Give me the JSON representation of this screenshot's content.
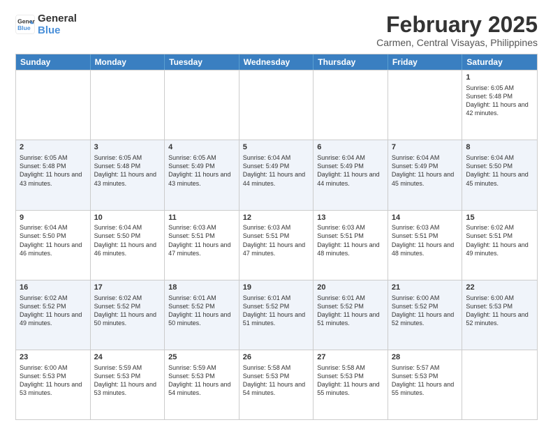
{
  "header": {
    "logo_line1": "General",
    "logo_line2": "Blue",
    "month_year": "February 2025",
    "location": "Carmen, Central Visayas, Philippines"
  },
  "weekdays": [
    "Sunday",
    "Monday",
    "Tuesday",
    "Wednesday",
    "Thursday",
    "Friday",
    "Saturday"
  ],
  "rows": [
    {
      "alt": false,
      "cells": [
        {
          "day": "",
          "text": ""
        },
        {
          "day": "",
          "text": ""
        },
        {
          "day": "",
          "text": ""
        },
        {
          "day": "",
          "text": ""
        },
        {
          "day": "",
          "text": ""
        },
        {
          "day": "",
          "text": ""
        },
        {
          "day": "1",
          "text": "Sunrise: 6:05 AM\nSunset: 5:48 PM\nDaylight: 11 hours and 42 minutes."
        }
      ]
    },
    {
      "alt": true,
      "cells": [
        {
          "day": "2",
          "text": "Sunrise: 6:05 AM\nSunset: 5:48 PM\nDaylight: 11 hours and 43 minutes."
        },
        {
          "day": "3",
          "text": "Sunrise: 6:05 AM\nSunset: 5:48 PM\nDaylight: 11 hours and 43 minutes."
        },
        {
          "day": "4",
          "text": "Sunrise: 6:05 AM\nSunset: 5:49 PM\nDaylight: 11 hours and 43 minutes."
        },
        {
          "day": "5",
          "text": "Sunrise: 6:04 AM\nSunset: 5:49 PM\nDaylight: 11 hours and 44 minutes."
        },
        {
          "day": "6",
          "text": "Sunrise: 6:04 AM\nSunset: 5:49 PM\nDaylight: 11 hours and 44 minutes."
        },
        {
          "day": "7",
          "text": "Sunrise: 6:04 AM\nSunset: 5:49 PM\nDaylight: 11 hours and 45 minutes."
        },
        {
          "day": "8",
          "text": "Sunrise: 6:04 AM\nSunset: 5:50 PM\nDaylight: 11 hours and 45 minutes."
        }
      ]
    },
    {
      "alt": false,
      "cells": [
        {
          "day": "9",
          "text": "Sunrise: 6:04 AM\nSunset: 5:50 PM\nDaylight: 11 hours and 46 minutes."
        },
        {
          "day": "10",
          "text": "Sunrise: 6:04 AM\nSunset: 5:50 PM\nDaylight: 11 hours and 46 minutes."
        },
        {
          "day": "11",
          "text": "Sunrise: 6:03 AM\nSunset: 5:51 PM\nDaylight: 11 hours and 47 minutes."
        },
        {
          "day": "12",
          "text": "Sunrise: 6:03 AM\nSunset: 5:51 PM\nDaylight: 11 hours and 47 minutes."
        },
        {
          "day": "13",
          "text": "Sunrise: 6:03 AM\nSunset: 5:51 PM\nDaylight: 11 hours and 48 minutes."
        },
        {
          "day": "14",
          "text": "Sunrise: 6:03 AM\nSunset: 5:51 PM\nDaylight: 11 hours and 48 minutes."
        },
        {
          "day": "15",
          "text": "Sunrise: 6:02 AM\nSunset: 5:51 PM\nDaylight: 11 hours and 49 minutes."
        }
      ]
    },
    {
      "alt": true,
      "cells": [
        {
          "day": "16",
          "text": "Sunrise: 6:02 AM\nSunset: 5:52 PM\nDaylight: 11 hours and 49 minutes."
        },
        {
          "day": "17",
          "text": "Sunrise: 6:02 AM\nSunset: 5:52 PM\nDaylight: 11 hours and 50 minutes."
        },
        {
          "day": "18",
          "text": "Sunrise: 6:01 AM\nSunset: 5:52 PM\nDaylight: 11 hours and 50 minutes."
        },
        {
          "day": "19",
          "text": "Sunrise: 6:01 AM\nSunset: 5:52 PM\nDaylight: 11 hours and 51 minutes."
        },
        {
          "day": "20",
          "text": "Sunrise: 6:01 AM\nSunset: 5:52 PM\nDaylight: 11 hours and 51 minutes."
        },
        {
          "day": "21",
          "text": "Sunrise: 6:00 AM\nSunset: 5:52 PM\nDaylight: 11 hours and 52 minutes."
        },
        {
          "day": "22",
          "text": "Sunrise: 6:00 AM\nSunset: 5:53 PM\nDaylight: 11 hours and 52 minutes."
        }
      ]
    },
    {
      "alt": false,
      "cells": [
        {
          "day": "23",
          "text": "Sunrise: 6:00 AM\nSunset: 5:53 PM\nDaylight: 11 hours and 53 minutes."
        },
        {
          "day": "24",
          "text": "Sunrise: 5:59 AM\nSunset: 5:53 PM\nDaylight: 11 hours and 53 minutes."
        },
        {
          "day": "25",
          "text": "Sunrise: 5:59 AM\nSunset: 5:53 PM\nDaylight: 11 hours and 54 minutes."
        },
        {
          "day": "26",
          "text": "Sunrise: 5:58 AM\nSunset: 5:53 PM\nDaylight: 11 hours and 54 minutes."
        },
        {
          "day": "27",
          "text": "Sunrise: 5:58 AM\nSunset: 5:53 PM\nDaylight: 11 hours and 55 minutes."
        },
        {
          "day": "28",
          "text": "Sunrise: 5:57 AM\nSunset: 5:53 PM\nDaylight: 11 hours and 55 minutes."
        },
        {
          "day": "",
          "text": ""
        }
      ]
    }
  ]
}
